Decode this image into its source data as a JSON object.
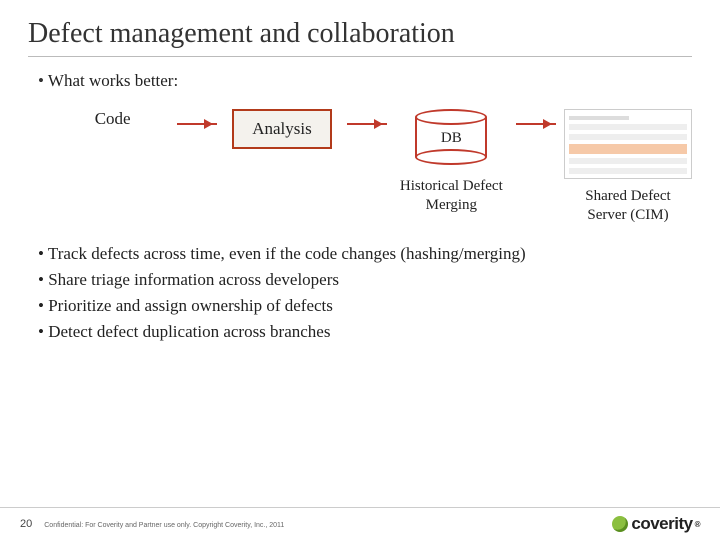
{
  "title": "Defect management and collaboration",
  "lead": "What works better:",
  "flow": {
    "code": "Code",
    "analysis": "Analysis",
    "db": "DB",
    "db_caption": "Historical Defect Merging",
    "server_caption": "Shared Defect Server (CIM)"
  },
  "bullets": [
    "Track defects across time, even if the code changes (hashing/merging)",
    "Share triage information across developers",
    "Prioritize and assign ownership of defects",
    "Detect defect duplication across branches"
  ],
  "footer": {
    "page": "20",
    "confidential": "Confidential: For Coverity and Partner use only. Copyright Coverity, Inc., 2011",
    "logo": "coverity",
    "logo_tm": "®"
  }
}
